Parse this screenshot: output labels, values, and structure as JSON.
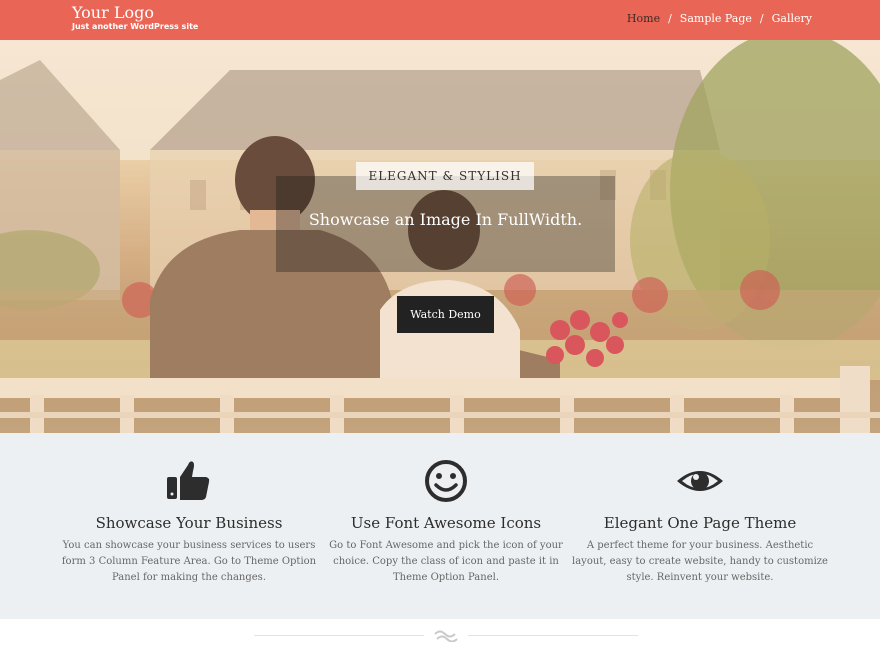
{
  "header": {
    "logo": "Your Logo",
    "tagline": "Just another WordPress site",
    "nav": [
      {
        "label": "Home"
      },
      {
        "label": "Sample Page"
      },
      {
        "label": "Gallery"
      }
    ],
    "nav_separator": "/",
    "accent_color": "#e96656"
  },
  "hero": {
    "kicker": "ELEGANT & STYLISH",
    "title": "Showcase an Image In FullWidth.",
    "button_label": "Watch Demo"
  },
  "features": [
    {
      "icon": "thumbs-up-icon",
      "title": "Showcase Your Business",
      "text": "You can showcase your business services to users form 3 Column Feature Area. Go to Theme Option Panel for making the changes."
    },
    {
      "icon": "smile-icon",
      "title": "Use Font Awesome Icons",
      "text": "Go to Font Awesome and pick the icon of your choice. Copy the class of icon and paste it in Theme Option Panel."
    },
    {
      "icon": "eye-icon",
      "title": "Elegant One Page Theme",
      "text": "A perfect theme for your business. Aesthetic layout, easy to create website, handy to customize style. Reinvent your website."
    }
  ],
  "divider_icon": "wave-icon"
}
